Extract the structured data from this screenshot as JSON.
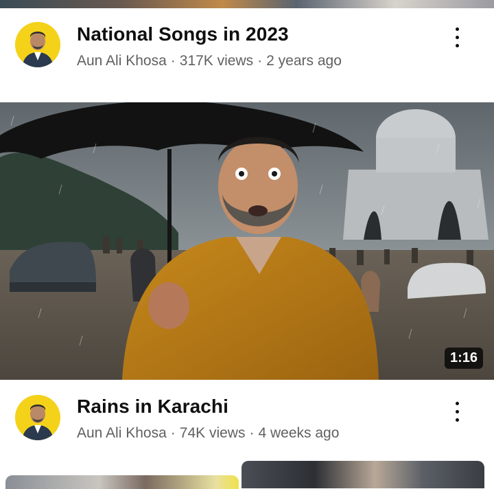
{
  "videos": [
    {
      "title": "National Songs in 2023",
      "channel": "Aun Ali Khosa",
      "views": "317K views",
      "age": "2 years ago",
      "separator": "·"
    },
    {
      "title": "Rains in Karachi",
      "channel": "Aun Ali Khosa",
      "views": "74K views",
      "age": "4 weeks ago",
      "separator": "·",
      "duration": "1:16"
    }
  ],
  "icons": {
    "more": "kebab-menu-icon",
    "avatar": "channel-avatar"
  },
  "colors": {
    "title": "#0f0f0f",
    "meta": "#606060",
    "avatar_bg": "#f4d21a",
    "duration_bg": "#000000"
  }
}
